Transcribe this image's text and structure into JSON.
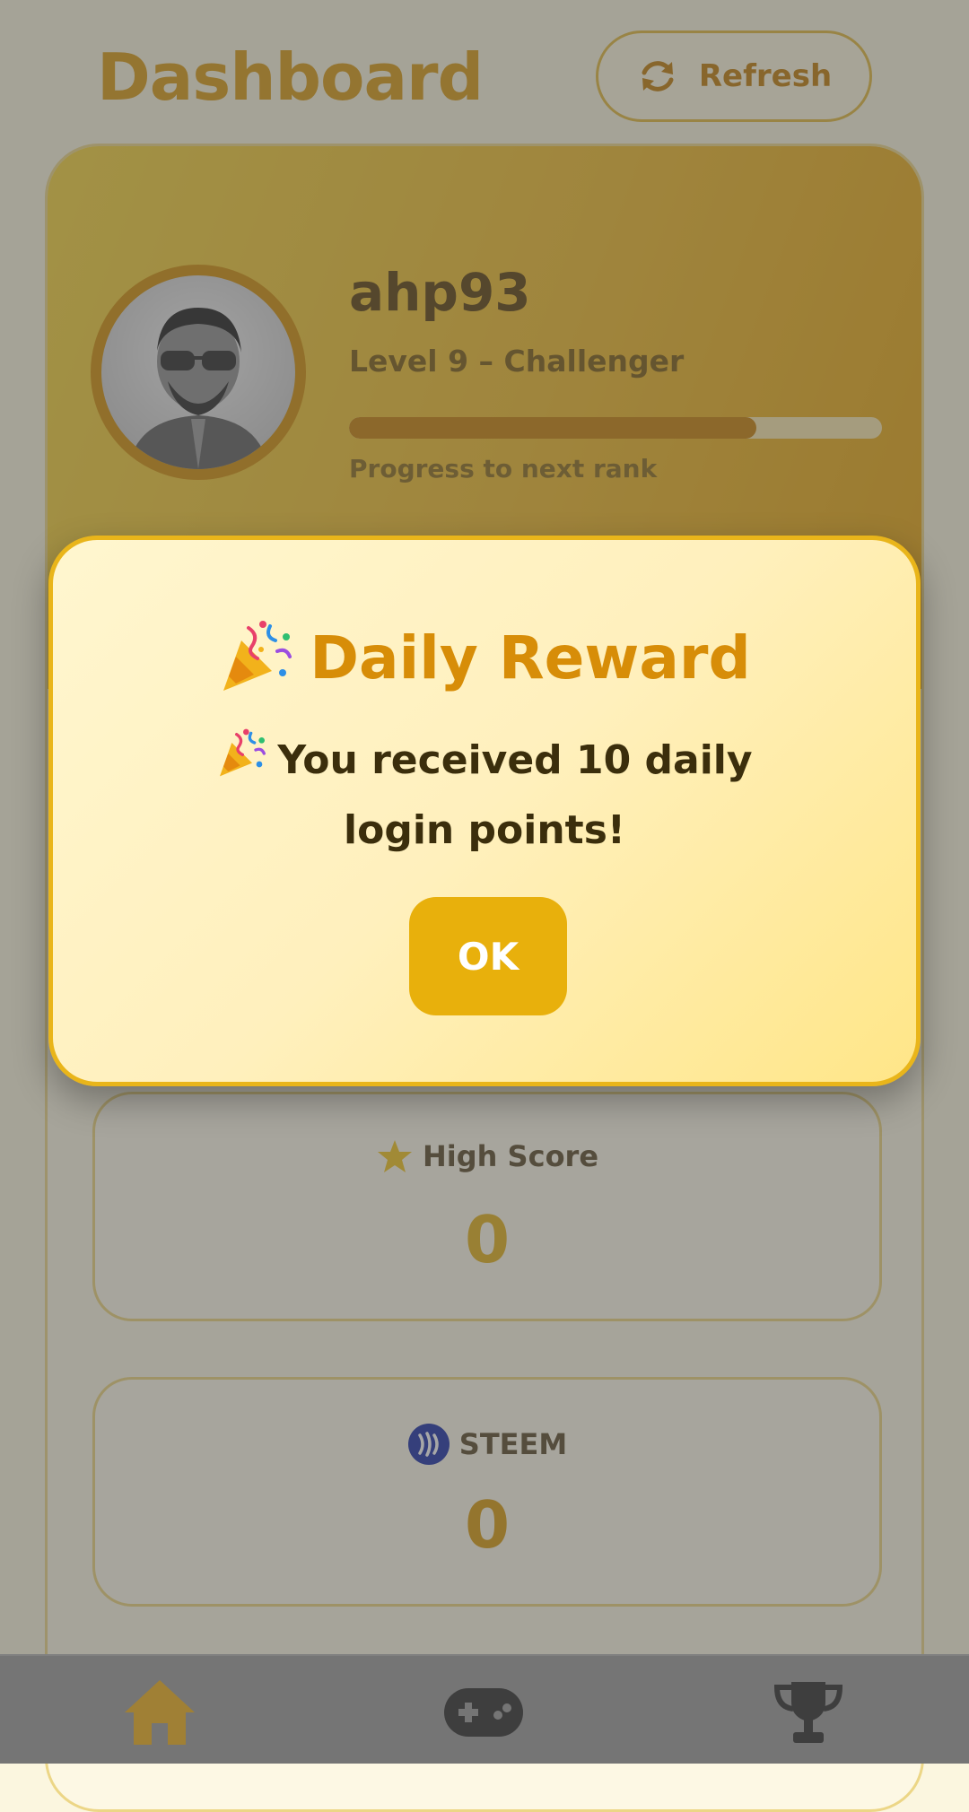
{
  "header": {
    "title": "Dashboard",
    "refresh_label": "Refresh"
  },
  "profile": {
    "username": "ahp93",
    "level_text": "Level 9 – Challenger",
    "progress_fraction": 0.765,
    "progress_label": "Progress to next rank"
  },
  "stats": {
    "high_score_label": "High Score",
    "high_score_value": "0",
    "steem_label": "STEEM",
    "steem_value": "0"
  },
  "modal": {
    "title": "Daily Reward",
    "message": "You received 10 daily login points!",
    "ok_label": "OK"
  },
  "nav": {
    "items": [
      {
        "icon": "home-icon",
        "active": true
      },
      {
        "icon": "gamepad-icon",
        "active": false
      },
      {
        "icon": "trophy-icon",
        "active": false
      }
    ]
  },
  "colors": {
    "accent": "#e8b00c",
    "title": "#d99a12",
    "banner_start": "#f4d43c",
    "banner_end": "#e7a40e",
    "steem_brand": "#1a2fa6"
  }
}
